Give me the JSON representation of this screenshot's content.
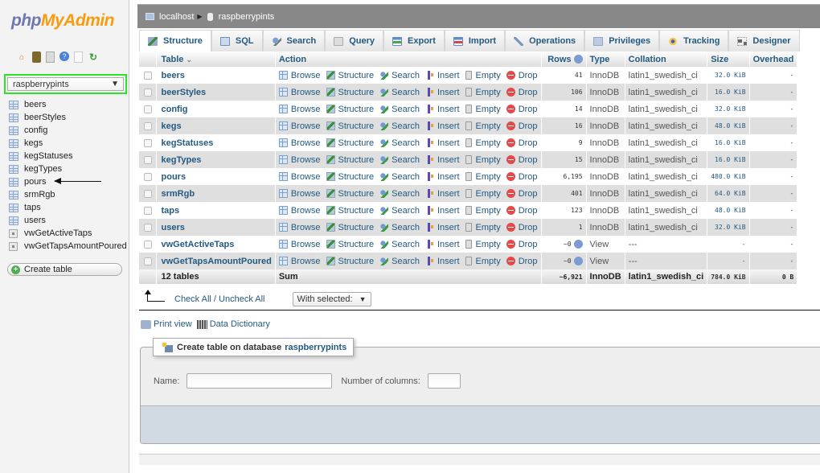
{
  "app": {
    "logo_php": "php",
    "logo_myadmin": "MyAdmin",
    "nav_icons": [
      "home-icon",
      "logout-icon",
      "query-window-icon",
      "help-icon",
      "documentation-icon",
      "reload-icon"
    ]
  },
  "sidebar": {
    "db_select": {
      "value": "raspberrypints"
    },
    "tables": [
      {
        "name": "beers",
        "kind": "table"
      },
      {
        "name": "beerStyles",
        "kind": "table"
      },
      {
        "name": "config",
        "kind": "table"
      },
      {
        "name": "kegs",
        "kind": "table"
      },
      {
        "name": "kegStatuses",
        "kind": "table"
      },
      {
        "name": "kegTypes",
        "kind": "table"
      },
      {
        "name": "pours",
        "kind": "table"
      },
      {
        "name": "srmRgb",
        "kind": "table"
      },
      {
        "name": "taps",
        "kind": "table"
      },
      {
        "name": "users",
        "kind": "table"
      },
      {
        "name": "vwGetActiveTaps",
        "kind": "view"
      },
      {
        "name": "vwGetTapsAmountPoured",
        "kind": "view"
      }
    ],
    "create_table_label": "Create table"
  },
  "breadcrumb": {
    "server": "localhost",
    "database": "raspberrypints"
  },
  "tabs": [
    {
      "label": "Structure",
      "icon": "structure-icon",
      "active": true
    },
    {
      "label": "SQL",
      "icon": "sql-icon",
      "active": false
    },
    {
      "label": "Search",
      "icon": "search-icon",
      "active": false
    },
    {
      "label": "Query",
      "icon": "query-icon",
      "active": false
    },
    {
      "label": "Export",
      "icon": "export-icon",
      "active": false
    },
    {
      "label": "Import",
      "icon": "import-icon",
      "active": false
    },
    {
      "label": "Operations",
      "icon": "operations-icon",
      "active": false
    },
    {
      "label": "Privileges",
      "icon": "privileges-icon",
      "active": false
    },
    {
      "label": "Tracking",
      "icon": "tracking-icon",
      "active": false
    },
    {
      "label": "Designer",
      "icon": "designer-icon",
      "active": false
    }
  ],
  "table": {
    "headers": {
      "table": "Table",
      "sort_indicator": "⌄",
      "action": "Action",
      "rows": "Rows",
      "type": "Type",
      "collation": "Collation",
      "size": "Size",
      "overhead": "Overhead"
    },
    "action_labels": {
      "browse": "Browse",
      "structure": "Structure",
      "search": "Search",
      "insert": "Insert",
      "empty": "Empty",
      "drop": "Drop"
    },
    "rows": [
      {
        "name": "beers",
        "rows": "41",
        "type": "InnoDB",
        "collation": "latin1_swedish_ci",
        "size": "32.0 KiB",
        "overhead": "-"
      },
      {
        "name": "beerStyles",
        "rows": "106",
        "type": "InnoDB",
        "collation": "latin1_swedish_ci",
        "size": "16.0 KiB",
        "overhead": "-"
      },
      {
        "name": "config",
        "rows": "14",
        "type": "InnoDB",
        "collation": "latin1_swedish_ci",
        "size": "32.0 KiB",
        "overhead": "-"
      },
      {
        "name": "kegs",
        "rows": "16",
        "type": "InnoDB",
        "collation": "latin1_swedish_ci",
        "size": "48.0 KiB",
        "overhead": "-"
      },
      {
        "name": "kegStatuses",
        "rows": "9",
        "type": "InnoDB",
        "collation": "latin1_swedish_ci",
        "size": "16.0 KiB",
        "overhead": "-"
      },
      {
        "name": "kegTypes",
        "rows": "15",
        "type": "InnoDB",
        "collation": "latin1_swedish_ci",
        "size": "16.0 KiB",
        "overhead": "-"
      },
      {
        "name": "pours",
        "rows": "6,195",
        "type": "InnoDB",
        "collation": "latin1_swedish_ci",
        "size": "480.0 KiB",
        "overhead": "-"
      },
      {
        "name": "srmRgb",
        "rows": "401",
        "type": "InnoDB",
        "collation": "latin1_swedish_ci",
        "size": "64.0 KiB",
        "overhead": "-"
      },
      {
        "name": "taps",
        "rows": "123",
        "type": "InnoDB",
        "collation": "latin1_swedish_ci",
        "size": "48.0 KiB",
        "overhead": "-"
      },
      {
        "name": "users",
        "rows": "1",
        "type": "InnoDB",
        "collation": "latin1_swedish_ci",
        "size": "32.0 KiB",
        "overhead": "-"
      },
      {
        "name": "vwGetActiveTaps",
        "rows": "~0",
        "type": "View",
        "collation": "---",
        "size": "-",
        "overhead": "-",
        "is_view": true
      },
      {
        "name": "vwGetTapsAmountPoured",
        "rows": "~0",
        "type": "View",
        "collation": "---",
        "size": "-",
        "overhead": "-",
        "is_view": true
      }
    ],
    "footer": {
      "count": "12 tables",
      "sum_label": "Sum",
      "rows": "~6,921",
      "type": "InnoDB",
      "collation": "latin1_swedish_ci",
      "size": "784.0 KiB",
      "overhead": "0 B"
    }
  },
  "bulk": {
    "check_all_label": "Check All / Uncheck All",
    "with_selected_label": "With selected:"
  },
  "links": {
    "print_view": "Print view",
    "data_dictionary": "Data Dictionary"
  },
  "create_table": {
    "legend_prefix": "Create table on database",
    "database": "raspberrypints",
    "name_label": "Name:",
    "name_value": "",
    "columns_label": "Number of columns:",
    "columns_value": ""
  }
}
